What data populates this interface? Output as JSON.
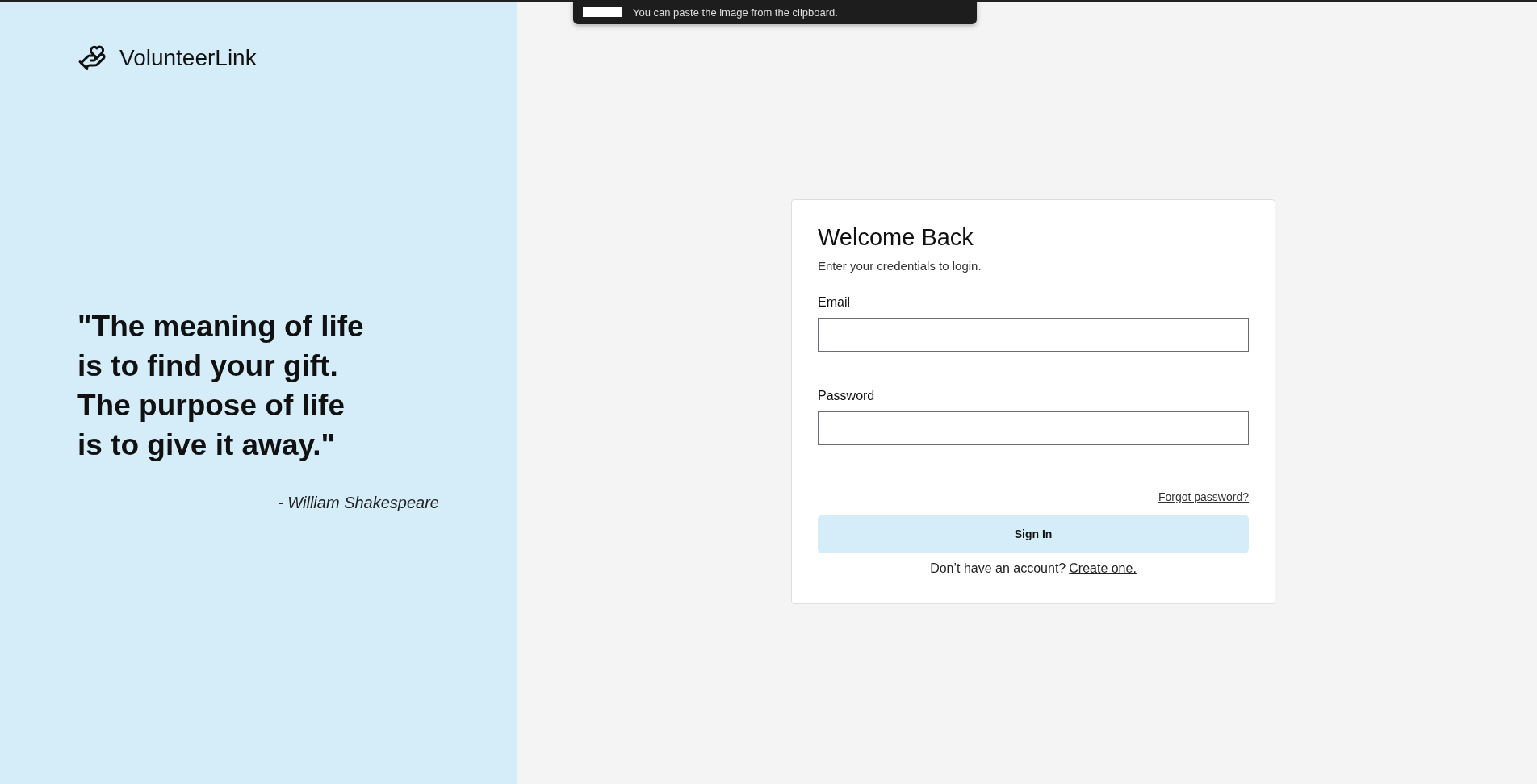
{
  "toast": {
    "message": "You can paste the image from the clipboard."
  },
  "brand": {
    "name": "VolunteerLink"
  },
  "quote": {
    "lines": [
      "\"The meaning of life",
      "is to find your gift.",
      "The purpose of life",
      "is to give it away.\""
    ],
    "author": "- William Shakespeare"
  },
  "login": {
    "title": "Welcome Back",
    "subtitle": "Enter your credentials to login.",
    "fields": [
      {
        "label": "Email"
      },
      {
        "label": "Password"
      }
    ],
    "forgot_link": "Forgot password?",
    "submit": "Sign In",
    "signup_prompt": "Don’t have an account?",
    "signup_link": "Create one."
  }
}
